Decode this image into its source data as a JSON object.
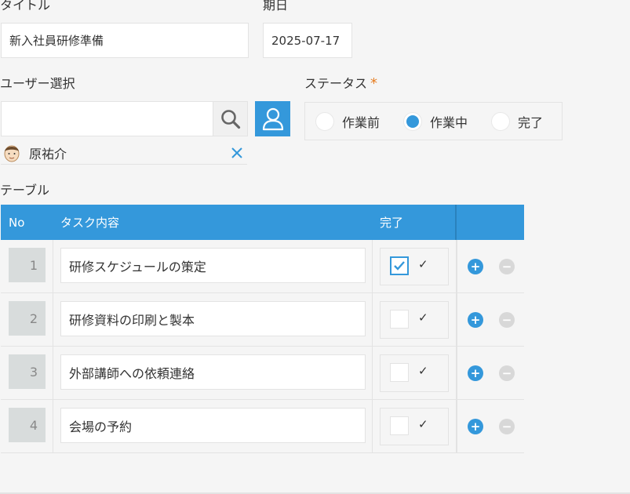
{
  "form": {
    "title": {
      "label": "タイトル",
      "value": "新入社員研修準備"
    },
    "due_date": {
      "label": "期日",
      "value": "2025-07-17"
    },
    "user_select": {
      "label": "ユーザー選択",
      "value": "",
      "selected_user": "原祐介"
    },
    "status": {
      "label": "ステータス",
      "required_mark": "*",
      "options": [
        "作業前",
        "作業中",
        "完了"
      ],
      "selected": "作業中"
    }
  },
  "table": {
    "label": "テーブル",
    "headers": {
      "no": "No",
      "task": "タスク内容",
      "done": "完了"
    },
    "rows": [
      {
        "no": "1",
        "task": "研修スケジュールの策定",
        "done": true,
        "done_label": "✓"
      },
      {
        "no": "2",
        "task": "研修資料の印刷と製本",
        "done": false,
        "done_label": "✓"
      },
      {
        "no": "3",
        "task": "外部講師への依頼連絡",
        "done": false,
        "done_label": "✓"
      },
      {
        "no": "4",
        "task": "会場の予約",
        "done": false,
        "done_label": "✓"
      }
    ]
  },
  "colors": {
    "accent": "#3498db",
    "required": "#e67e22",
    "background": "#f5f5f5"
  },
  "icons": [
    "search-icon",
    "user-icon",
    "close-icon",
    "checkmark-icon",
    "add-row-icon",
    "remove-row-icon"
  ]
}
